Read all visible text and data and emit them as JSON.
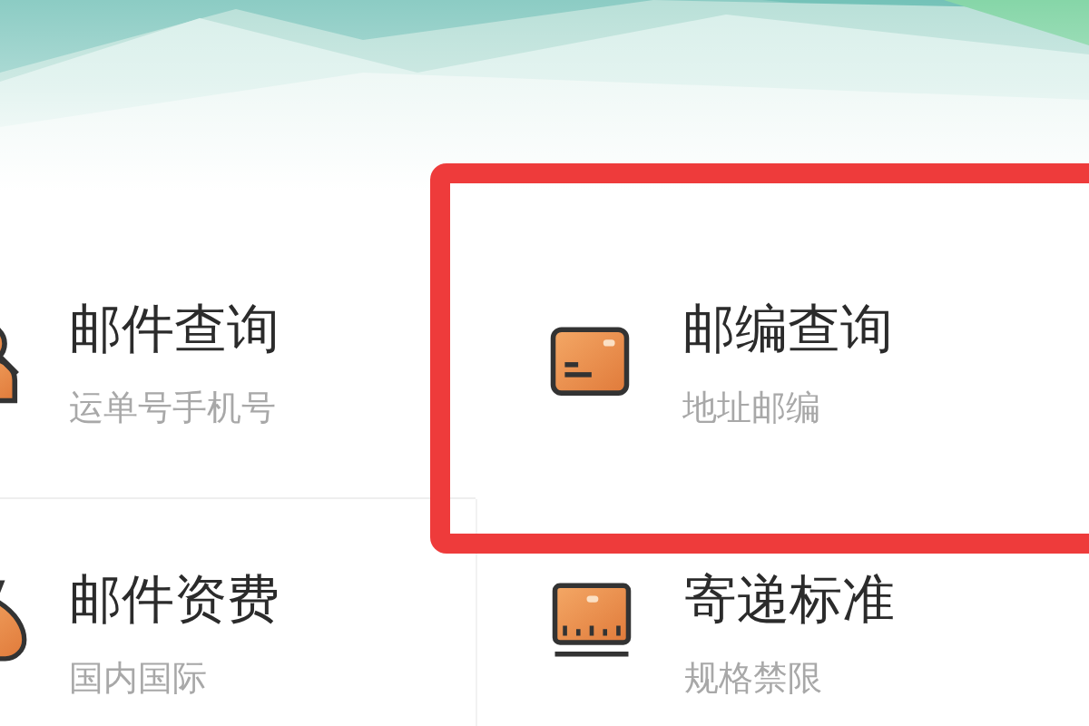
{
  "services": [
    {
      "title": "邮件查询",
      "subtitle": "运单号手机号",
      "kind": "search",
      "highlighted": false
    },
    {
      "title": "邮编查询",
      "subtitle": "地址邮编",
      "kind": "card",
      "highlighted": true
    },
    {
      "title": "邮件资费",
      "subtitle": "国内国际",
      "kind": "bag",
      "highlighted": false
    },
    {
      "title": "寄递标准",
      "subtitle": "规格禁限",
      "kind": "ruler",
      "highlighted": false
    }
  ]
}
